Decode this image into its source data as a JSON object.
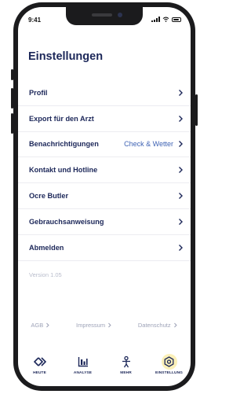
{
  "status_bar": {
    "time": "9:41"
  },
  "page": {
    "title": "Einstellungen"
  },
  "menu": {
    "items": [
      {
        "label": "Profil",
        "value": ""
      },
      {
        "label": "Export für den Arzt",
        "value": ""
      },
      {
        "label": "Benachrichtigungen",
        "value": "Check & Wetter"
      },
      {
        "label": "Kontakt und Hotline",
        "value": ""
      },
      {
        "label": "Ocre Butler",
        "value": ""
      },
      {
        "label": "Gebrauchsanweisung",
        "value": ""
      },
      {
        "label": "Abmelden",
        "value": ""
      }
    ]
  },
  "version": "Version 1.05",
  "footer_links": [
    {
      "label": "AGB"
    },
    {
      "label": "Impressum"
    },
    {
      "label": "Datenschutz"
    }
  ],
  "tabbar": {
    "tabs": [
      {
        "label": "HEUTE",
        "icon": "chevrons-icon"
      },
      {
        "label": "ANALYSE",
        "icon": "chart-icon"
      },
      {
        "label": "MEHR",
        "icon": "person-icon"
      },
      {
        "label": "EINSTELLUNG",
        "icon": "settings-hexagon-icon",
        "active": true
      }
    ]
  },
  "colors": {
    "primary": "#1c2759",
    "accent_value": "#3f63b4",
    "active_tab_bg": "#fbf0b8",
    "muted": "#9ea3b8"
  }
}
